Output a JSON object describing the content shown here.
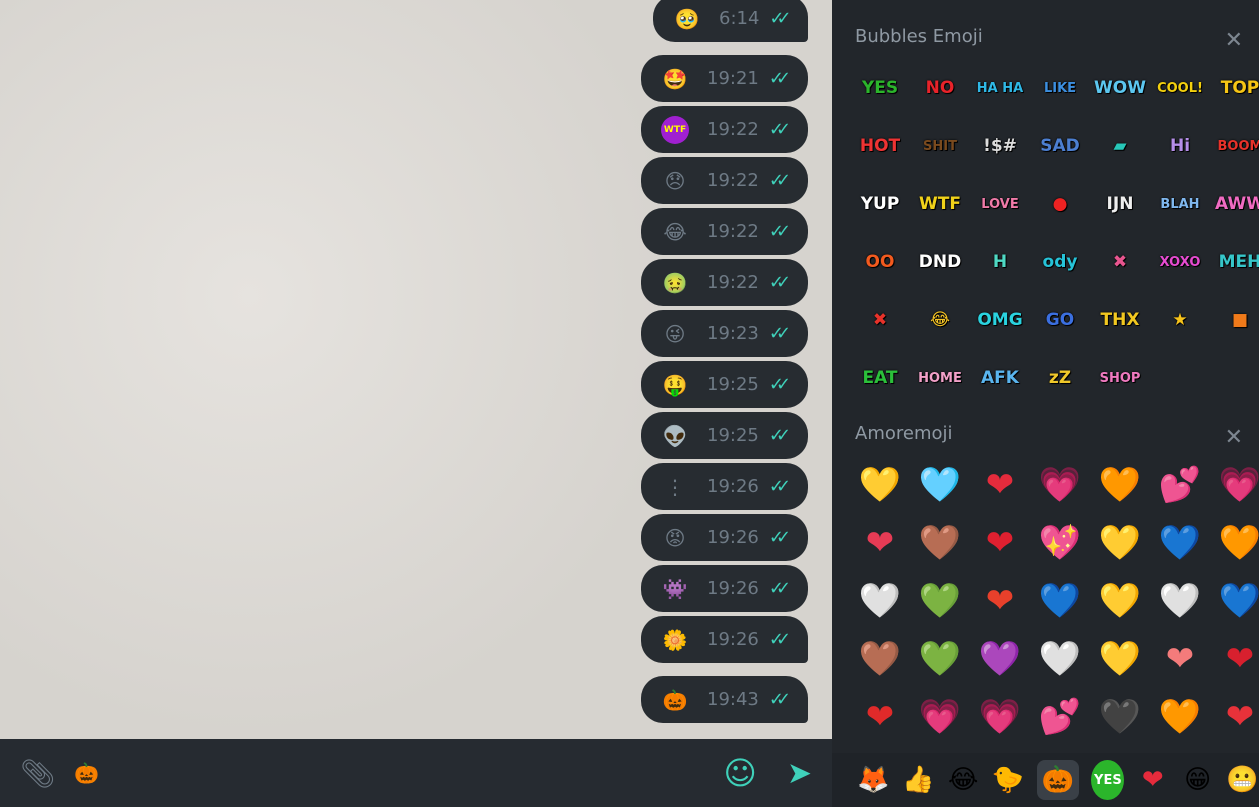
{
  "messages": [
    {
      "emoji": "🥹",
      "time": "6:14",
      "tail": true
    },
    {
      "emoji": "🤩",
      "time": "19:21"
    },
    {
      "emoji": "WTF",
      "time": "19:22"
    },
    {
      "emoji": "😞",
      "time": "19:22"
    },
    {
      "emoji": "😂",
      "time": "19:22"
    },
    {
      "emoji": "🤢",
      "time": "19:22"
    },
    {
      "emoji": "😜",
      "time": "19:23"
    },
    {
      "emoji": "🤑",
      "time": "19:25"
    },
    {
      "emoji": "👽",
      "time": "19:25"
    },
    {
      "emoji": "⋮",
      "time": "19:26"
    },
    {
      "emoji": "😡",
      "time": "19:26"
    },
    {
      "emoji": "👾",
      "time": "19:26"
    },
    {
      "emoji": "🌼",
      "time": "19:26",
      "tail": true
    },
    {
      "emoji": "🎃",
      "time": "19:43",
      "tail": true
    }
  ],
  "read_icon": "double-check-icon",
  "input": {
    "attach_icon": "paperclip-icon",
    "text": "🎃",
    "emoji_icon": "smiley-icon",
    "send_icon": "send-icon"
  },
  "panel": {
    "sections": [
      {
        "title": "Bubbles Emoji",
        "stickers": [
          {
            "t": "YES",
            "c": "#2bb52b"
          },
          {
            "t": "NO",
            "c": "#e8232a"
          },
          {
            "t": "HA HA",
            "c": "#2fb8e6"
          },
          {
            "t": "LIKE",
            "c": "#3c8fe0"
          },
          {
            "t": "WOW",
            "c": "#5cc7f0"
          },
          {
            "t": "COOL!",
            "c": "#f3d00e"
          },
          {
            "t": "TOP",
            "c": "#f6c515"
          },
          {
            "t": "HOT",
            "c": "#e33"
          },
          {
            "t": "SHIT",
            "c": "#7a4a1e"
          },
          {
            "t": "!$#",
            "c": "#ddd"
          },
          {
            "t": "SAD",
            "c": "#4c7fd1"
          },
          {
            "t": "▰",
            "c": "#27c7b8"
          },
          {
            "t": "Hi",
            "c": "#b58de8"
          },
          {
            "t": "BOOM",
            "c": "#e8322a"
          },
          {
            "t": "YUP",
            "c": "#fff"
          },
          {
            "t": "WTF",
            "c": "#f1d21a"
          },
          {
            "t": "LOVE",
            "c": "#f07aa8"
          },
          {
            "t": "●",
            "c": "#e22"
          },
          {
            "t": "IJN",
            "c": "#eee"
          },
          {
            "t": "BLAH",
            "c": "#7fb7ee"
          },
          {
            "t": "AWW",
            "c": "#f06bc2"
          },
          {
            "t": "OO",
            "c": "#f35a1e"
          },
          {
            "t": "DND",
            "c": "#fff"
          },
          {
            "t": "H",
            "c": "#4fd9c4"
          },
          {
            "t": "ody",
            "c": "#26c3d8"
          },
          {
            "t": "✖",
            "c": "#e8558f"
          },
          {
            "t": "XOXO",
            "c": "#e64bd1"
          },
          {
            "t": "MEH",
            "c": "#36c6c9"
          },
          {
            "t": "✖",
            "c": "#e8322a"
          },
          {
            "t": "😂",
            "c": "#f5c324"
          },
          {
            "t": "OMG",
            "c": "#2ad3e0"
          },
          {
            "t": "GO",
            "c": "#3b6fe0"
          },
          {
            "t": "THX",
            "c": "#f2c820"
          },
          {
            "t": "★",
            "c": "#f7c31b"
          },
          {
            "t": "■",
            "c": "#f07a1a"
          },
          {
            "t": "EAT",
            "c": "#2bc03a"
          },
          {
            "t": "HOME",
            "c": "#f2a0c8"
          },
          {
            "t": "AFK",
            "c": "#5ab5ef"
          },
          {
            "t": "zZ",
            "c": "#f0c82a"
          },
          {
            "t": "SHOP",
            "c": "#f07ac0"
          }
        ]
      },
      {
        "title": "Amoremoji",
        "stickers": [
          {
            "t": "💛",
            "c": "#f5c81f"
          },
          {
            "t": "🩵",
            "c": "#cfe3ef"
          },
          {
            "t": "❤",
            "c": "#e52b3c"
          },
          {
            "t": "💗",
            "c": "#f079c0"
          },
          {
            "t": "🧡",
            "c": "#f59a1e"
          },
          {
            "t": "💕",
            "c": "#f05f9a"
          },
          {
            "t": "💗",
            "c": "#f04fa8"
          },
          {
            "t": "❤",
            "c": "#e63b55"
          },
          {
            "t": "🤎",
            "c": "#c87a3b"
          },
          {
            "t": "❤",
            "c": "#e02030"
          },
          {
            "t": "💖",
            "c": "#ef4aa0"
          },
          {
            "t": "💛",
            "c": "#f5b820"
          },
          {
            "t": "💙",
            "c": "#2f7fe0"
          },
          {
            "t": "🧡",
            "c": "#f5b020"
          },
          {
            "t": "🤍",
            "c": "#d4e2ee"
          },
          {
            "t": "💚",
            "c": "#2bb36a"
          },
          {
            "t": "❤",
            "c": "#e8402b"
          },
          {
            "t": "💙",
            "c": "#4a9de8"
          },
          {
            "t": "💛",
            "c": "#f7e07a"
          },
          {
            "t": "🤍",
            "c": "#dce6ee"
          },
          {
            "t": "💙",
            "c": "#2f6fd0"
          },
          {
            "t": "🤎",
            "c": "#b0592f"
          },
          {
            "t": "💚",
            "c": "#7fcc55"
          },
          {
            "t": "💜",
            "c": "#a43fd0"
          },
          {
            "t": "🤍",
            "c": "#e6eef5"
          },
          {
            "t": "💛",
            "c": "#f5d040"
          },
          {
            "t": "❤",
            "c": "#f47b7b"
          },
          {
            "t": "❤",
            "c": "#d8202e"
          },
          {
            "t": "❤",
            "c": "#e02a2a"
          },
          {
            "t": "💗",
            "c": "#f06ab0"
          },
          {
            "t": "💗",
            "c": "#e23d9a"
          },
          {
            "t": "💕",
            "c": "#e04f90"
          },
          {
            "t": "🖤",
            "c": "#6a3a2a"
          },
          {
            "t": "🧡",
            "c": "#d8802a"
          },
          {
            "t": "❤",
            "c": "#e8323a"
          }
        ]
      }
    ],
    "close_icon": "close-icon"
  },
  "tabs": [
    {
      "icon": "fox-mask-icon",
      "g": "🦊"
    },
    {
      "icon": "thumbs-up-icon",
      "g": "👍"
    },
    {
      "icon": "laughing-blob-icon",
      "g": "😂"
    },
    {
      "icon": "duck-icon",
      "g": "🐤"
    },
    {
      "icon": "pumpkin-icon",
      "g": "🎃",
      "active": true
    },
    {
      "icon": "yes-bubble-icon",
      "g": "YES"
    },
    {
      "icon": "heart-face-icon",
      "g": "❤"
    },
    {
      "icon": "grin-icon",
      "g": "😁"
    },
    {
      "icon": "grin-brown-icon",
      "g": "😬"
    }
  ]
}
